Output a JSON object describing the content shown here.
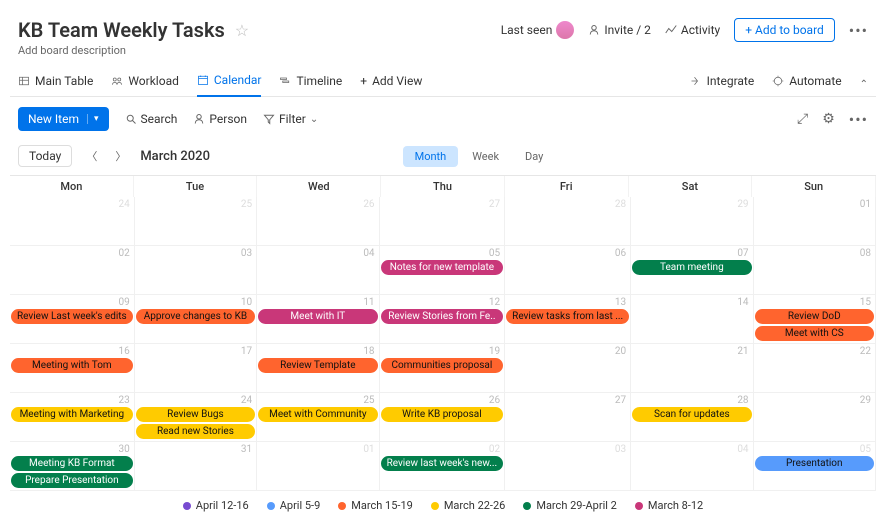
{
  "header": {
    "title": "KB Team Weekly Tasks",
    "description": "Add board description",
    "last_seen": "Last seen",
    "invite": "Invite / 2",
    "activity": "Activity",
    "add_to_board": "Add to board"
  },
  "tabs": {
    "main_table": "Main Table",
    "workload": "Workload",
    "calendar": "Calendar",
    "timeline": "Timeline",
    "add_view": "Add View",
    "integrate": "Integrate",
    "automate": "Automate"
  },
  "toolbar": {
    "new_item": "New Item",
    "search": "Search",
    "person": "Person",
    "filter": "Filter"
  },
  "view": {
    "today": "Today",
    "month_label": "March 2020",
    "seg_month": "Month",
    "seg_week": "Week",
    "seg_day": "Day"
  },
  "days": [
    "Mon",
    "Tue",
    "Wed",
    "Thu",
    "Fri",
    "Sat",
    "Sun"
  ],
  "cells": [
    {
      "num": "24",
      "light": true
    },
    {
      "num": "25",
      "light": true
    },
    {
      "num": "26",
      "light": true
    },
    {
      "num": "27",
      "light": true
    },
    {
      "num": "28",
      "light": true
    },
    {
      "num": "29",
      "light": true
    },
    {
      "num": "01"
    },
    {
      "num": "02"
    },
    {
      "num": "03"
    },
    {
      "num": "04"
    },
    {
      "num": "05",
      "events": [
        {
          "t": "Notes for new template",
          "c": "pink"
        }
      ]
    },
    {
      "num": "06"
    },
    {
      "num": "07",
      "events": [
        {
          "t": "Team meeting",
          "c": "green"
        }
      ]
    },
    {
      "num": "08"
    },
    {
      "num": "09",
      "events": [
        {
          "t": "Review Last week's edits",
          "c": "orange"
        }
      ]
    },
    {
      "num": "10",
      "events": [
        {
          "t": "Approve changes to KB",
          "c": "orange"
        }
      ]
    },
    {
      "num": "11",
      "events": [
        {
          "t": "Meet with IT",
          "c": "pink"
        }
      ]
    },
    {
      "num": "12",
      "events": [
        {
          "t": "Review Stories from Fe..",
          "c": "pink"
        }
      ]
    },
    {
      "num": "13",
      "events": [
        {
          "t": "Review tasks from last ...",
          "c": "orange"
        }
      ]
    },
    {
      "num": "14"
    },
    {
      "num": "15",
      "events": [
        {
          "t": "Review DoD",
          "c": "orange"
        },
        {
          "t": "Meet with CS",
          "c": "orange"
        }
      ]
    },
    {
      "num": "16",
      "events": [
        {
          "t": "Meeting with Tom",
          "c": "orange"
        }
      ]
    },
    {
      "num": "17"
    },
    {
      "num": "18",
      "events": [
        {
          "t": "Review Template",
          "c": "orange"
        }
      ]
    },
    {
      "num": "19",
      "events": [
        {
          "t": "Communities proposal",
          "c": "orange"
        }
      ]
    },
    {
      "num": "20"
    },
    {
      "num": "21"
    },
    {
      "num": "22"
    },
    {
      "num": "23",
      "events": [
        {
          "t": "Meeting with Marketing",
          "c": "yellow"
        }
      ]
    },
    {
      "num": "24",
      "events": [
        {
          "t": "Review Bugs",
          "c": "yellow"
        },
        {
          "t": "Read new Stories",
          "c": "yellow"
        }
      ]
    },
    {
      "num": "25",
      "events": [
        {
          "t": "Meet with Community",
          "c": "yellow"
        }
      ]
    },
    {
      "num": "26",
      "events": [
        {
          "t": "Write KB proposal",
          "c": "yellow"
        }
      ]
    },
    {
      "num": "27"
    },
    {
      "num": "28",
      "events": [
        {
          "t": "Scan for updates",
          "c": "yellow"
        }
      ]
    },
    {
      "num": "29"
    },
    {
      "num": "30",
      "events": [
        {
          "t": "Meeting KB Format",
          "c": "green"
        },
        {
          "t": "Prepare Presentation",
          "c": "green"
        }
      ]
    },
    {
      "num": "31"
    },
    {
      "num": "01",
      "light": true
    },
    {
      "num": "02",
      "light": true,
      "events": [
        {
          "t": "Review last week's new...",
          "c": "green"
        }
      ]
    },
    {
      "num": "03",
      "light": true
    },
    {
      "num": "04",
      "light": true
    },
    {
      "num": "05",
      "light": true,
      "events": [
        {
          "t": "Presentation",
          "c": "blue"
        }
      ]
    }
  ],
  "legend": [
    {
      "label": "April 12-16",
      "color": "#784bd1"
    },
    {
      "label": "April 5-9",
      "color": "#579bfc"
    },
    {
      "label": "March 15-19",
      "color": "#ff642e"
    },
    {
      "label": "March 22-26",
      "color": "#ffcb00"
    },
    {
      "label": "March 29-April 2",
      "color": "#037f4c"
    },
    {
      "label": "March 8-12",
      "color": "#c93779"
    }
  ]
}
